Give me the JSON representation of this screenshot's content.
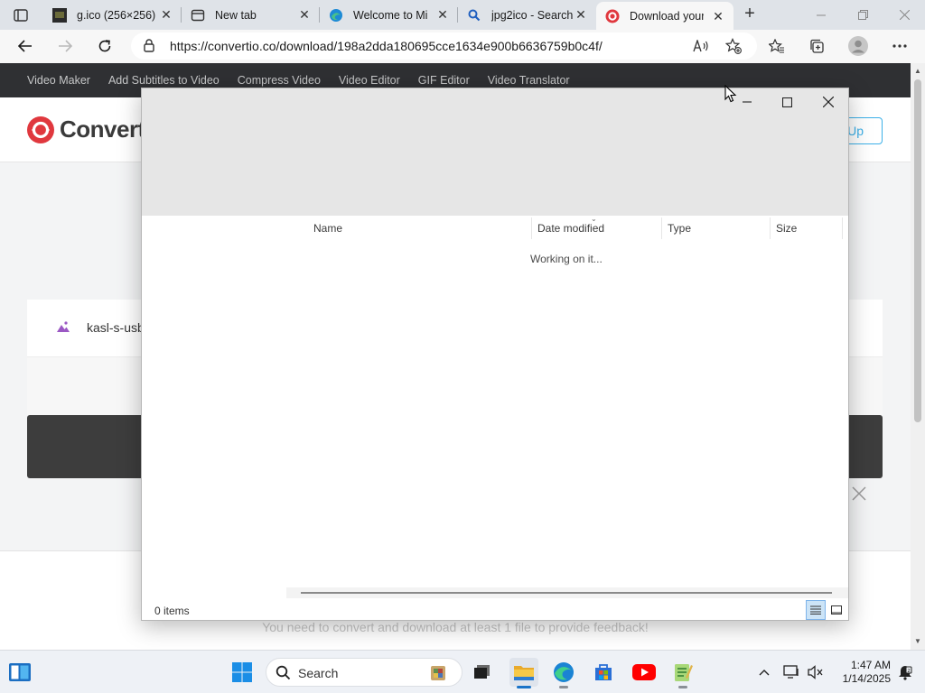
{
  "browser": {
    "tabs": [
      {
        "title": "g.ico (256×256)",
        "icon": "image-favicon-icon"
      },
      {
        "title": "New tab",
        "icon": "newtab-favicon-icon"
      },
      {
        "title": "Welcome to Mi",
        "icon": "edge-favicon-icon"
      },
      {
        "title": "jpg2ico - Search",
        "icon": "search-favicon-icon"
      },
      {
        "title": "Download your",
        "icon": "convertio-favicon-icon",
        "active": true
      }
    ],
    "url": "https://convertio.co/download/198a2dda180695cce1634e900b6636759b0c4f/"
  },
  "site": {
    "nav": [
      "Video Maker",
      "Add Subtitles to Video",
      "Compress Video",
      "Video Editor",
      "GIF Editor",
      "Video Translator"
    ],
    "logo_text": "Convert",
    "signup_label": "Up",
    "file_name": "kasl-s-usb",
    "feedback_text": "You need to convert and download at least 1 file to provide feedback!",
    "brand_color": "#e0383e",
    "accent_color": "#3cb0e8"
  },
  "dialog": {
    "columns": [
      "Name",
      "Date modified",
      "Type",
      "Size"
    ],
    "status_message": "Working on it...",
    "item_count": "0 items"
  },
  "taskbar": {
    "search_label": "Search",
    "time": "1:47 AM",
    "date": "1/14/2025"
  }
}
